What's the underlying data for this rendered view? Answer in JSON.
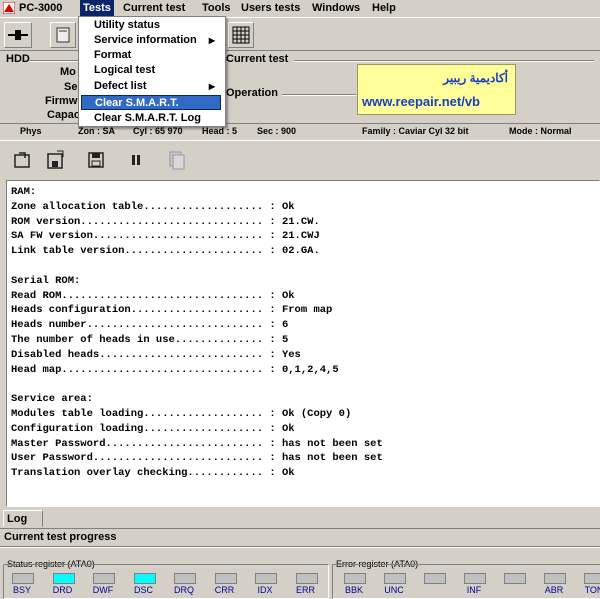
{
  "menubar": {
    "app": "PC-3000",
    "items": [
      "Tests",
      "Current test",
      "Tools",
      "Users tests",
      "Windows",
      "Help"
    ]
  },
  "dropdown": {
    "items": [
      {
        "label": "Utility status",
        "submenu": false
      },
      {
        "label": "Service information",
        "submenu": true
      },
      {
        "label": "Format",
        "submenu": false
      },
      {
        "label": "Logical test",
        "submenu": false
      },
      {
        "label": "Defect list",
        "submenu": true
      },
      {
        "label": "Clear S.M.A.R.T.",
        "submenu": false,
        "highlighted": true
      },
      {
        "label": "Clear S.M.A.R.T. Log",
        "submenu": false
      }
    ]
  },
  "info": {
    "hdd_label": "HDD",
    "current_test_label": "Current test",
    "operation_label": "Operation",
    "truncated": [
      "Mo",
      "Se",
      "Firmw",
      "Capac"
    ]
  },
  "banner": {
    "arabic": "أكاديمية ريبير",
    "url": "www.reepair.net/vb"
  },
  "strip": {
    "phys": "Phys",
    "zone": "Zon : SA",
    "cyl": "Cyl : 65 970",
    "head": "Head : 5",
    "sec": "Sec : 900",
    "family": "Family : Caviar Cyl 32 bit",
    "mode": "Mode : Normal"
  },
  "log": {
    "lines": [
      "RAM:",
      "Zone allocation table................... : Ok",
      "ROM version............................. : 21.CW.",
      "SA FW version........................... : 21.CWJ",
      "Link table version...................... : 02.GA.",
      "",
      "Serial ROM:",
      "Read ROM................................ : Ok",
      "Heads configuration..................... : From map",
      "Heads number............................ : 6",
      "The number of heads in use.............. : 5",
      "Disabled heads.......................... : Yes",
      "Head map................................ : 0,1,2,4,5",
      "",
      "Service area:",
      "Modules table loading................... : Ok (Copy 0)",
      "Configuration loading................... : Ok",
      "Master Password......................... : has not been set",
      "User Password........................... : has not been set",
      "Translation overlay checking............ : Ok"
    ]
  },
  "tabs": {
    "log": "Log"
  },
  "progress_label": "Current test progress",
  "status_register": {
    "title": "Status register (ATA0)",
    "leds": [
      {
        "label": "BSY",
        "on": false
      },
      {
        "label": "DRD",
        "on": true
      },
      {
        "label": "DWF",
        "on": false
      },
      {
        "label": "DSC",
        "on": true
      },
      {
        "label": "DRQ",
        "on": false
      },
      {
        "label": "CRR",
        "on": false
      },
      {
        "label": "IDX",
        "on": false
      },
      {
        "label": "ERR",
        "on": false
      }
    ]
  },
  "error_register": {
    "title": "Error register (ATA0)",
    "leds": [
      {
        "label": "BBK",
        "on": false
      },
      {
        "label": "UNC",
        "on": false
      },
      {
        "label": "",
        "on": false
      },
      {
        "label": "INF",
        "on": false
      },
      {
        "label": "",
        "on": false
      },
      {
        "label": "ABR",
        "on": false
      },
      {
        "label": "TON",
        "on": false
      }
    ]
  },
  "colors": {
    "led_on": "#00ffff",
    "menu_select": "#0a246a",
    "highlight": "#316ac5",
    "banner_bg": "#ffff99"
  }
}
